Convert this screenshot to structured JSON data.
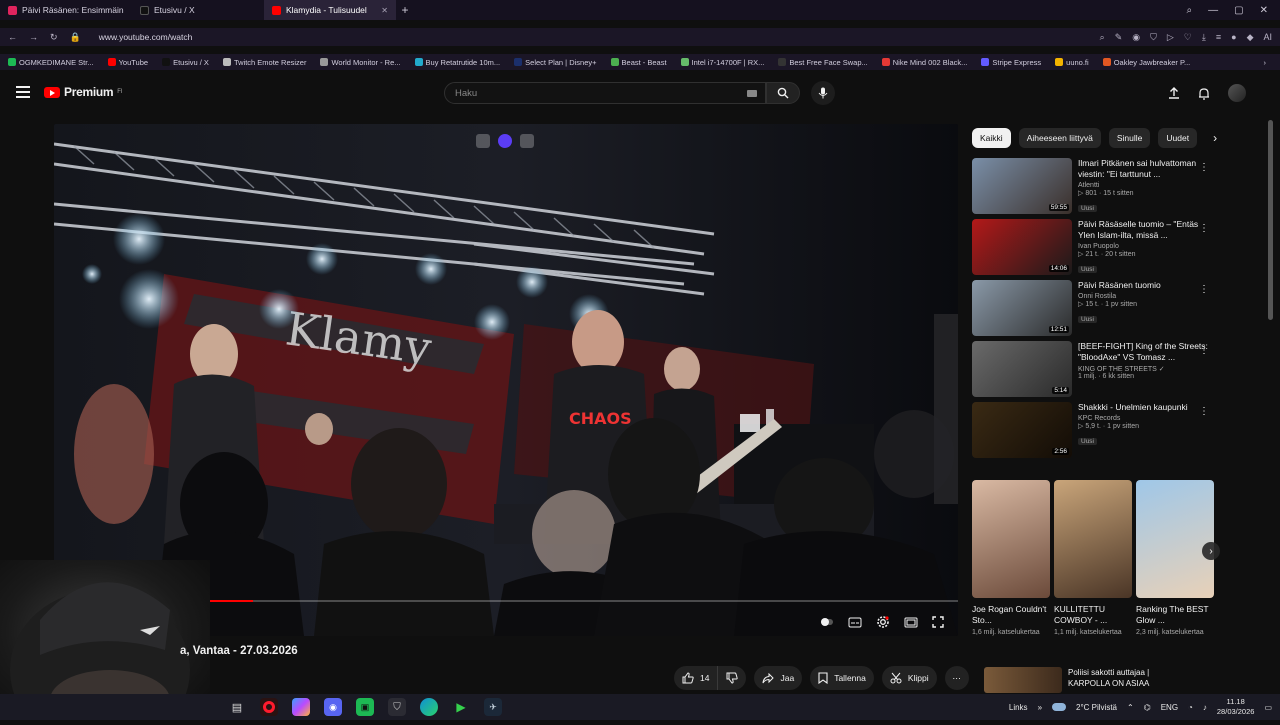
{
  "browser": {
    "tabs": [
      {
        "label": "Päivi Räsänen: Ensimmäin",
        "fav": "#e0245e"
      },
      {
        "label": "Etusivu / X",
        "fav": "#111111"
      },
      {
        "label": "Klamydia - Tulisuudel",
        "fav": "#ff0000",
        "active": true
      }
    ],
    "new_tab": "+",
    "url": "www.youtube.com/watch",
    "ai_label": "AI",
    "bookmarks": [
      {
        "label": "OGMKEDIMANE Str...",
        "color": "#1db954"
      },
      {
        "label": "YouTube",
        "color": "#ff0000"
      },
      {
        "label": "Etusivu / X",
        "color": "#111111"
      },
      {
        "label": "Twitch Emote Resizer",
        "color": "#bbbbbb"
      },
      {
        "label": "World Monitor - Re...",
        "color": "#999999"
      },
      {
        "label": "Buy Retatrutide 10m...",
        "color": "#22aacc"
      },
      {
        "label": "Select Plan | Disney+",
        "color": "#1b2f6b"
      },
      {
        "label": "Beast - Beast",
        "color": "#4caf50"
      },
      {
        "label": "Intel i7-14700F | RX...",
        "color": "#66bb6a"
      },
      {
        "label": "Best Free Face Swap...",
        "color": "#333333"
      },
      {
        "label": "Nike Mind 002 Black...",
        "color": "#e53935"
      },
      {
        "label": "Stripe Express",
        "color": "#635bff"
      },
      {
        "label": "uuno.fi",
        "color": "#f4b400"
      },
      {
        "label": "Oakley Jawbreaker P...",
        "color": "#e25822"
      }
    ]
  },
  "yt": {
    "logo_text": "Premium",
    "logo_sup": "FI",
    "search_placeholder": "Haku",
    "video_title": "a, Vantaa - 27.03.2026",
    "progress": 0.22,
    "actions": {
      "likes": "14",
      "share": "Jaa",
      "save": "Tallenna",
      "clip": "Klippi",
      "more": "⋯"
    },
    "chips": [
      "Kaikki",
      "Aiheeseen liittyvä",
      "Sinulle",
      "Uudet"
    ],
    "recs": [
      {
        "title": "Ilmari Pitkänen sai hulvattoman viestin: \"Ei tarttunut ...",
        "channel": "Atlentti",
        "meta": "▷ 801 · 15 t sitten",
        "badge": "Uusi",
        "duration": "59:55",
        "colors": [
          "#7a8fa8",
          "#3a2f2a"
        ]
      },
      {
        "title": "Päivi Räsäselle tuomio – \"Entäs Ylen Islam-ilta, missä ...",
        "channel": "Ivan Puopolo",
        "meta": "▷ 21 t. · 20 t sitten",
        "badge": "Uusi",
        "duration": "14:06",
        "colors": [
          "#b31919",
          "#1a1a1a"
        ]
      },
      {
        "title": "Päivi Räsänen tuomio",
        "channel": "Onni Rostila",
        "meta": "▷ 15 t. · 1 pv sitten",
        "badge": "Uusi",
        "duration": "12:51",
        "colors": [
          "#8a99a8",
          "#2b2b2b"
        ]
      },
      {
        "title": "[BEEF-FIGHT] King of the Streets: \"BloodAxe\" VS Tomasz ...",
        "channel": "KING OF THE STREETS ✓",
        "meta": "1 milj. · 6 kk sitten",
        "badge": "",
        "duration": "5:14",
        "colors": [
          "#6a6a6a",
          "#2a2a2a"
        ]
      },
      {
        "title": "Shakkki - Unelmien kaupunki",
        "channel": "KPC Records",
        "meta": "▷ 5,9 t. · 1 pv sitten",
        "badge": "Uusi",
        "duration": "2:56",
        "colors": [
          "#3a2a14",
          "#120c06"
        ]
      }
    ],
    "shorts": [
      {
        "title": "Joe Rogan Couldn't Sto...",
        "views": "1,6 milj. katselukertaa",
        "colors": [
          "#d9b9a3",
          "#6b4a3a"
        ]
      },
      {
        "title": "KULLITETTU COWBOY - ...",
        "views": "1,1 milj. katselukertaa",
        "colors": [
          "#c9a57a",
          "#4a3526"
        ]
      },
      {
        "title": "Ranking The BEST Glow ...",
        "views": "2,3 milj. katselukertaa",
        "colors": [
          "#9fc7e8",
          "#e8d1b8"
        ]
      }
    ],
    "last_rec": {
      "title": "Poliisi sakotti auttajaa | KARPOLLA ON ASIAA"
    }
  },
  "taskbar": {
    "links_label": "Links",
    "weather": "2°C  Pilvistä",
    "lang": "ENG",
    "time": "11.18",
    "date": "28/03/2026"
  }
}
